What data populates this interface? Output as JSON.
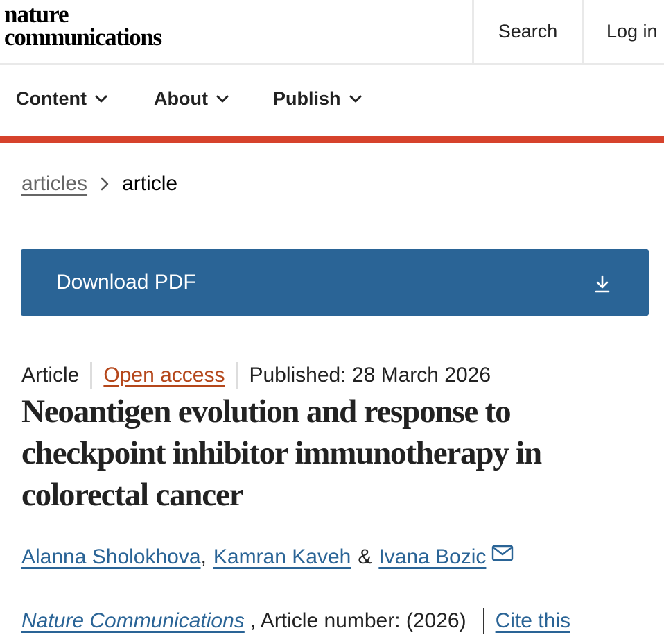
{
  "header": {
    "logo_line1": "nature",
    "logo_line2": "communications",
    "search_label": "Search",
    "login_label": "Log in"
  },
  "nav": {
    "items": [
      {
        "label": "Content"
      },
      {
        "label": "About"
      },
      {
        "label": "Publish"
      }
    ]
  },
  "breadcrumb": {
    "parent": "articles",
    "current": "article"
  },
  "download": {
    "label": "Download PDF"
  },
  "article": {
    "type": "Article",
    "access": "Open access",
    "published": "Published: 28 March 2026",
    "title": "Neoantigen evolution and response to checkpoint inhibitor immunotherapy in colorectal cancer",
    "authors": [
      {
        "name": "Alanna Sholokhova"
      },
      {
        "name": "Kamran Kaveh"
      },
      {
        "name": "Ivana Bozic"
      }
    ],
    "author_sep_comma": ",",
    "author_sep_amp": "&",
    "journal": "Nature Communications",
    "article_number_text": ", Article number:  (2026)",
    "cite_label": "Cite this"
  },
  "colors": {
    "accent_red": "#d6422c",
    "download_blue": "#2a6496",
    "open_access_orange": "#b5471b",
    "link_blue": "#2a6496"
  },
  "icons": {
    "nav_chevron": "chevron-down-icon",
    "breadcrumb_sep": "chevron-right-icon",
    "download": "download-icon",
    "mail": "mail-icon"
  }
}
